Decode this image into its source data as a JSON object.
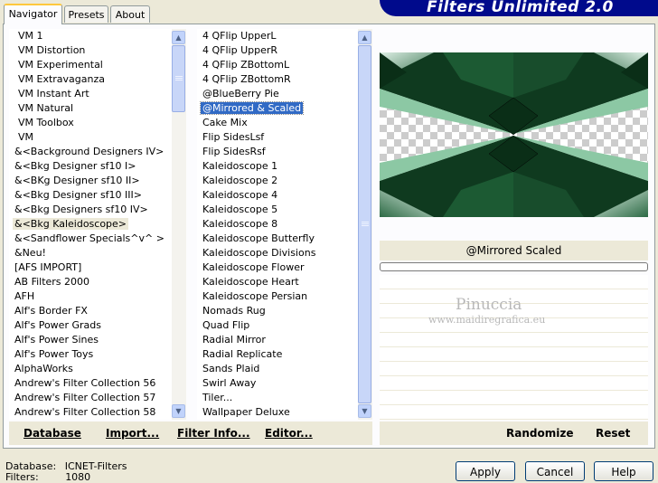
{
  "tabs": [
    "Navigator",
    "Presets",
    "About"
  ],
  "banner_title": "Filters Unlimited 2.0",
  "categories": {
    "items": [
      "VM 1",
      "VM Distortion",
      "VM Experimental",
      "VM Extravaganza",
      "VM Instant Art",
      "VM Natural",
      "VM Toolbox",
      "VM",
      "&<Background Designers IV>",
      "&<Bkg Designer sf10 I>",
      "&<BKg Designer sf10 II>",
      "&<Bkg Designer sf10 III>",
      "&<Bkg Designers sf10 IV>",
      "&<Bkg Kaleidoscope>",
      "&<Sandflower Specials^v^ >",
      "&Neu!",
      "[AFS IMPORT]",
      "AB Filters 2000",
      "AFH",
      "Alf's Border FX",
      "Alf's Power Grads",
      "Alf's Power Sines",
      "Alf's Power Toys",
      "AlphaWorks",
      "Andrew's Filter Collection 56",
      "Andrew's Filter Collection 57",
      "Andrew's Filter Collection 58"
    ],
    "highlighted_index": 13
  },
  "filters": {
    "items": [
      "4 QFlip UpperL",
      "4 QFlip UpperR",
      "4 QFlip ZBottomL",
      "4 QFlip ZBottomR",
      "@BlueBerry Pie",
      "@Mirrored & Scaled",
      "Cake Mix",
      "Flip SidesLsf",
      "Flip SidesRsf",
      "Kaleidoscope 1",
      "Kaleidoscope 2",
      "Kaleidoscope 4",
      "Kaleidoscope 5",
      "Kaleidoscope 8",
      "Kaleidoscope Butterfly",
      "Kaleidoscope Divisions",
      "Kaleidoscope Flower",
      "Kaleidoscope Heart",
      "Kaleidoscope Persian",
      "Nomads Rug",
      "Quad Flip",
      "Radial Mirror",
      "Radial Replicate",
      "Sands Plaid",
      "Swirl Away",
      "Tiler...",
      "Wallpaper Deluxe"
    ],
    "selected_index": 5
  },
  "left_bar": {
    "database": "Database",
    "import": "Import...",
    "filter_info": "Filter Info...",
    "editor": "Editor..."
  },
  "right_bar": {
    "randomize": "Randomize",
    "reset": "Reset"
  },
  "preview_caption": "@Mirrored  Scaled",
  "watermark": {
    "name": "Pinuccia",
    "url": "www.maidiregrafica.eu"
  },
  "status": {
    "database_label": "Database:",
    "database_value": "ICNET-Filters",
    "filters_label": "Filters:",
    "filters_value": "1080"
  },
  "buttons": {
    "apply": "Apply",
    "cancel": "Cancel",
    "help": "Help"
  },
  "colors": {
    "banner": "#000a8c",
    "selection": "#316ac5",
    "preview_dark_green": "#0f3a1f",
    "preview_light_green": "#9fd0b0"
  }
}
